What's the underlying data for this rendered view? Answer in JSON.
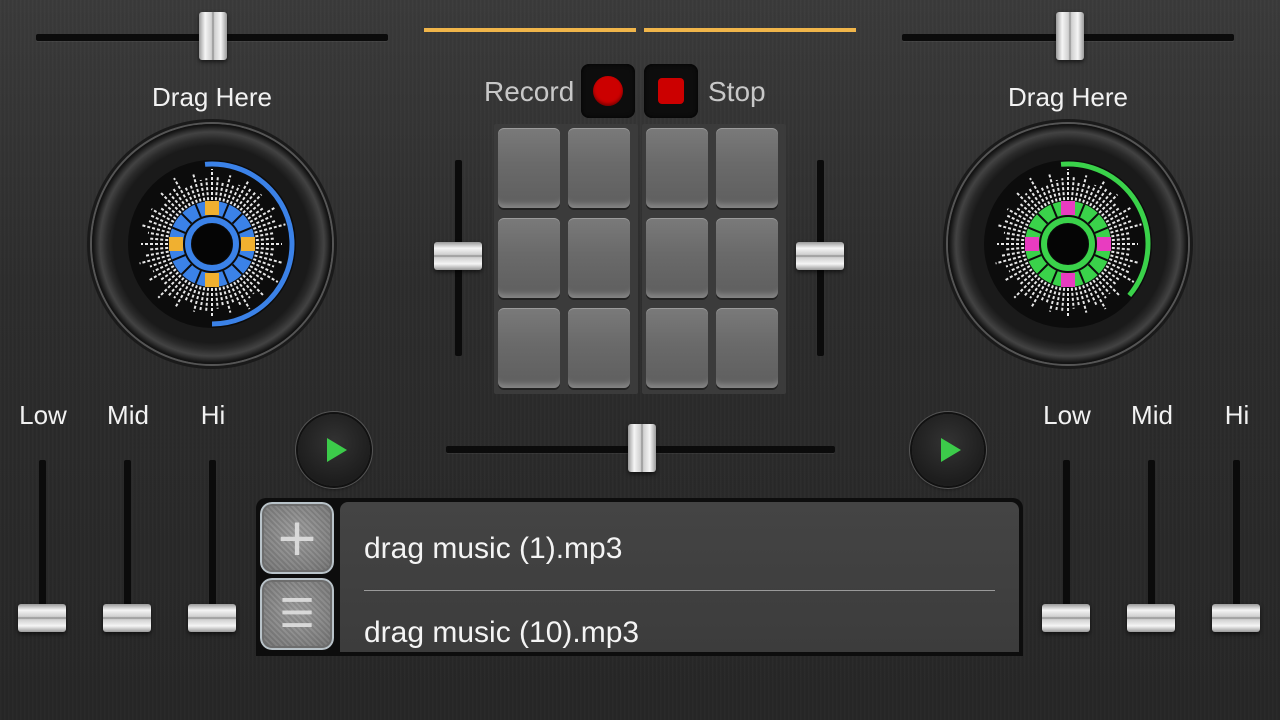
{
  "left_deck": {
    "label": "Drag Here",
    "eq": [
      {
        "label": "Low"
      },
      {
        "label": "Mid"
      },
      {
        "label": "Hi"
      }
    ],
    "disc_accent": "#3b82e8",
    "disc_marker": "#f0b030"
  },
  "right_deck": {
    "label": "Drag Here",
    "eq": [
      {
        "label": "Low"
      },
      {
        "label": "Mid"
      },
      {
        "label": "Hi"
      }
    ],
    "disc_accent": "#3ad24a",
    "disc_marker": "#e83cc0"
  },
  "recorder": {
    "record_label": "Record",
    "stop_label": "Stop"
  },
  "playlist": {
    "items": [
      "drag music (1).mp3",
      "drag music (10).mp3"
    ],
    "add_icon": "plus-icon",
    "menu_icon": "menu-icon"
  },
  "colors": {
    "tab_accent": "#f0b54a",
    "record_red": "#cc0000",
    "play_green": "#3ccb4a"
  }
}
